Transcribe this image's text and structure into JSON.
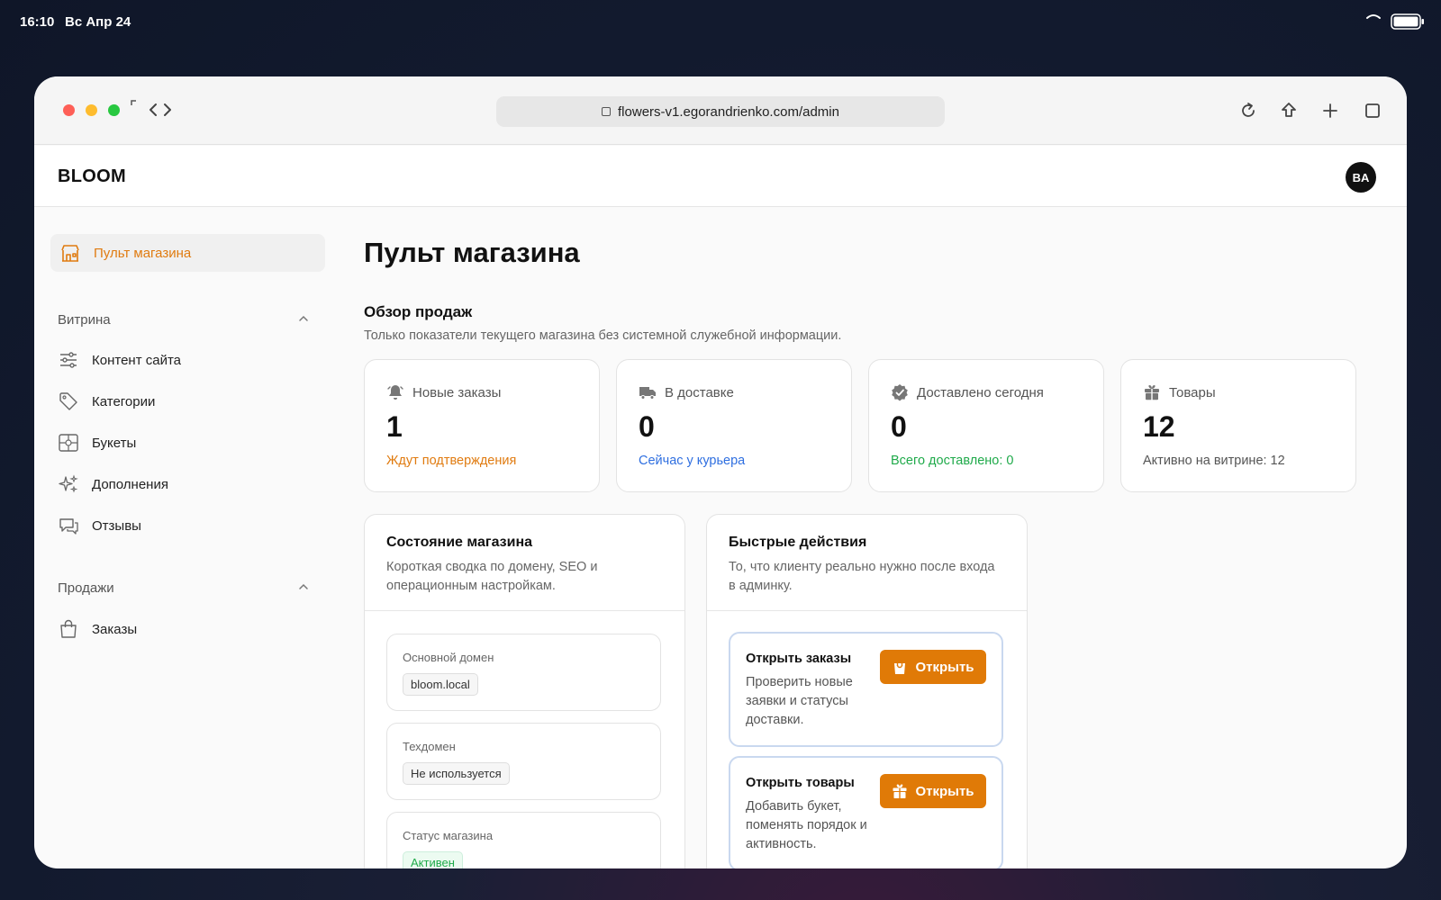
{
  "status_bar": {
    "time": "16:10",
    "date": "Вс Апр 24"
  },
  "browser": {
    "url": "flowers-v1.egorandrienko.com/admin"
  },
  "header": {
    "brand": "BLOOM",
    "avatar_initials": "BA"
  },
  "sidebar": {
    "active": {
      "label": "Пульт магазина",
      "icon": "store-icon"
    },
    "sections": [
      {
        "title": "Витрина",
        "items": [
          {
            "label": "Контент сайта",
            "icon": "sliders-icon"
          },
          {
            "label": "Категории",
            "icon": "tag-icon"
          },
          {
            "label": "Букеты",
            "icon": "bouquet-icon"
          },
          {
            "label": "Дополнения",
            "icon": "sparkles-icon"
          },
          {
            "label": "Отзывы",
            "icon": "chat-icon"
          }
        ]
      },
      {
        "title": "Продажи",
        "items": [
          {
            "label": "Заказы",
            "icon": "bag-icon"
          }
        ]
      }
    ]
  },
  "main": {
    "title": "Пульт магазина",
    "overview": {
      "title": "Обзор продаж",
      "subtitle": "Только показатели текущего магазина без системной служебной информации."
    },
    "stats": [
      {
        "label": "Новые заказы",
        "value": "1",
        "note": "Ждут подтверждения",
        "note_color": "#e07b10",
        "icon": "bell-icon"
      },
      {
        "label": "В доставке",
        "value": "0",
        "note": "Сейчас у курьера",
        "note_color": "#2f6fe0",
        "icon": "truck-icon"
      },
      {
        "label": "Доставлено сегодня",
        "value": "0",
        "note": "Всего доставлено: 0",
        "note_color": "#1faa4a",
        "icon": "check-badge-icon"
      },
      {
        "label": "Товары",
        "value": "12",
        "note": "Активно на витрине: 12",
        "note_color": "#555555",
        "icon": "gift-icon"
      }
    ],
    "store_state": {
      "title": "Состояние магазина",
      "subtitle": "Короткая сводка по домену, SEO и операционным настройкам.",
      "fields": [
        {
          "label": "Основной домен",
          "value": "bloom.local"
        },
        {
          "label": "Техдомен",
          "value": "Не используется"
        },
        {
          "label": "Статус магазина",
          "value": "Активен"
        }
      ]
    },
    "quick_actions": {
      "title": "Быстрые действия",
      "subtitle": "То, что клиенту реально нужно после входа в админку.",
      "items": [
        {
          "title": "Открыть заказы",
          "description": "Проверить новые заявки и статусы доставки.",
          "button": "Открыть",
          "icon": "bag-icon"
        },
        {
          "title": "Открыть товары",
          "description": "Добавить букет, поменять порядок и активность.",
          "button": "Открыть",
          "icon": "gift-icon"
        }
      ]
    }
  },
  "colors": {
    "accent": "#e07a07",
    "blue": "#2f6fe0",
    "green": "#1faa4a"
  }
}
